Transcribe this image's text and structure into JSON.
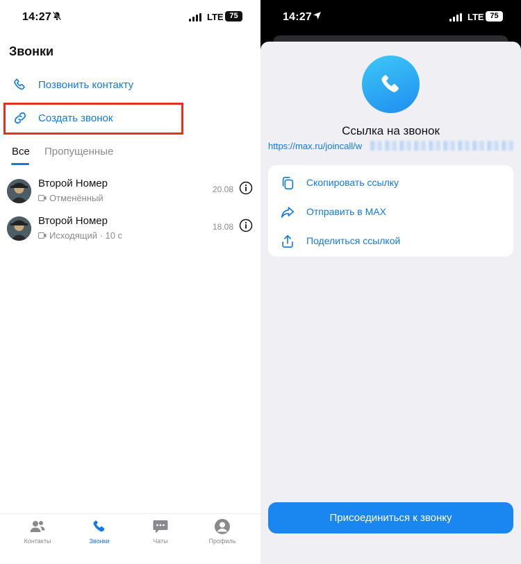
{
  "colors": {
    "accent": "#1479e0",
    "highlight": "#e7301e",
    "muted": "#8a8a8e",
    "join_button": "#1a86f0"
  },
  "left": {
    "status": {
      "time": "14:27",
      "icon": "bell-slash-icon",
      "network": "LTE",
      "battery": "75"
    },
    "title": "Звонки",
    "actions": [
      {
        "label": "Позвонить контакту",
        "icon": "phone-icon"
      },
      {
        "label": "Создать звонок",
        "icon": "link-icon"
      }
    ],
    "tabs": [
      "Все",
      "Пропущенные"
    ],
    "calls": [
      {
        "name": "Второй Номер",
        "status": "Отменённый",
        "date": "20.08",
        "icon": "video-icon"
      },
      {
        "name": "Второй Номер",
        "status": "Исходящий · 10 с",
        "date": "18.08",
        "icon": "video-icon"
      }
    ],
    "nav": [
      {
        "label": "Контакты",
        "icon": "contacts-icon"
      },
      {
        "label": "Звонки",
        "icon": "phone-icon",
        "active": true
      },
      {
        "label": "Чаты",
        "icon": "chat-icon"
      },
      {
        "label": "Профиль",
        "icon": "profile-icon"
      }
    ]
  },
  "right": {
    "status": {
      "time": "14:27",
      "icon": "location-arrow-icon",
      "network": "LTE",
      "battery": "75"
    },
    "sheet_title": "Ссылка на звонок",
    "link_prefix": "https://max.ru/joincall/w",
    "actions": [
      {
        "label": "Скопировать ссылку",
        "icon": "copy-icon"
      },
      {
        "label": "Отправить в MAX",
        "icon": "forward-icon"
      },
      {
        "label": "Поделиться ссылкой",
        "icon": "share-icon"
      }
    ],
    "join_button": "Присоединиться к звонку"
  }
}
